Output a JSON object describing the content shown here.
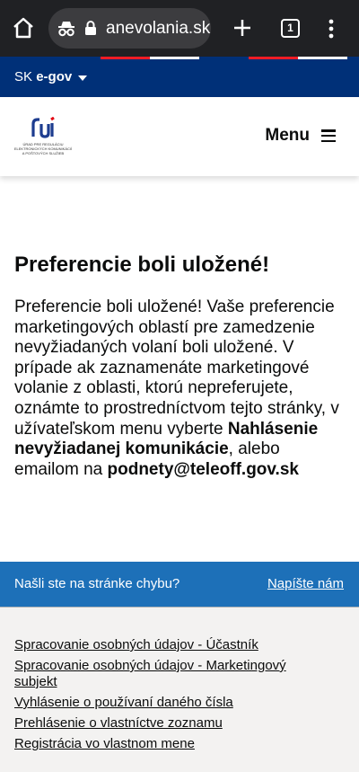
{
  "browser": {
    "url": "anevolania.sk",
    "tab_count": "1",
    "icons": [
      "home-icon",
      "incognito-icon",
      "lock-icon",
      "plus-icon",
      "tab-counter-icon",
      "kebab-menu-icon"
    ]
  },
  "govbar": {
    "prefix": "SK",
    "brand": "e-gov",
    "colors": {
      "background": "#003078",
      "stripe_red": "#ee1c25",
      "stripe_white": "#ffffff"
    }
  },
  "header": {
    "logo_lines": [
      "ÚRAD PRE REGULÁCIU",
      "ELEKTRONICKÝCH KOMUNIKÁCIÍ",
      "A POŠTOVÝCH SLUŽIEB"
    ],
    "menu_label": "Menu",
    "colors": {
      "logo_blue": "#1d3c8f",
      "logo_red": "#e30613"
    }
  },
  "main": {
    "title": "Preferencie boli uložené!",
    "body_1": "Preferencie boli uložené! Vaše preferencie marketingových oblastí pre zamedzenie nevyžiadaných volaní boli uložené. V prípade ak zaznamenáte marketingové volanie z oblasti, ktorú nepreferujete, oznámte to prostredníctvom tejto stránky, v užívateľskom menu vyberte ",
    "body_bold_1": "Nahlásenie nevyžiadanej komunikácie",
    "body_2": ", alebo emailom na ",
    "body_bold_2": "podnety@teleoff.gov.sk"
  },
  "feedback": {
    "question": "Našli ste na stránke chybu?",
    "link": "Napíšte nám",
    "color": "#1d70b8"
  },
  "footer": {
    "links": [
      "Spracovanie osobných údajov - Účastník",
      "Spracovanie osobných údajov - Marketingový subjekt",
      "Vyhlásenie o používaní daného čísla",
      "Prehlásenie o vlastníctve zoznamu",
      "Registrácia vo vlastnom mene"
    ],
    "color": "#f3f2f1"
  }
}
